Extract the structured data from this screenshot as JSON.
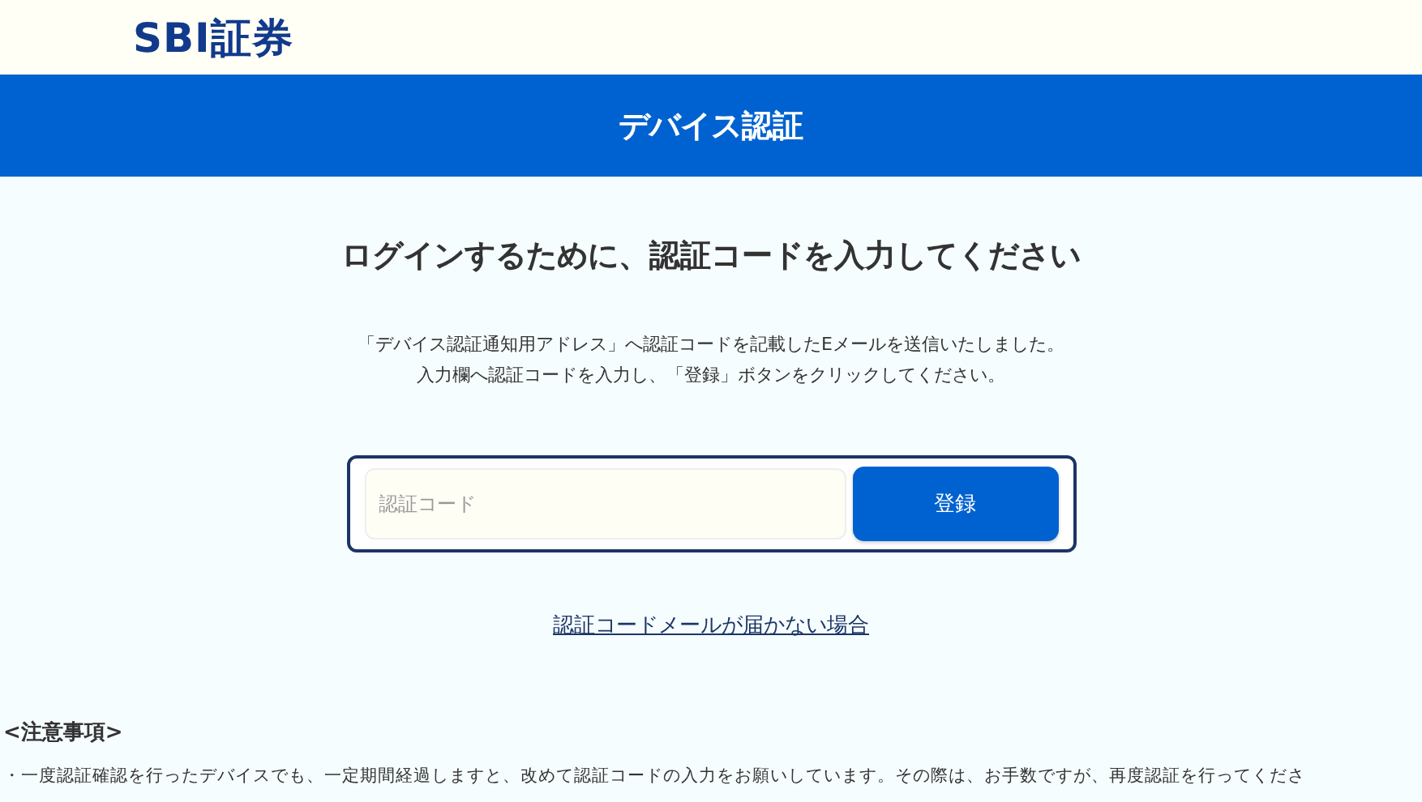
{
  "logo": "SBI証券",
  "banner": {
    "title": "デバイス認証"
  },
  "heading": "ログインするために、認証コードを入力してください",
  "instructions": [
    "「デバイス認証通知用アドレス」へ認証コードを記載したEメールを送信いたしました。",
    "入力欄へ認証コードを入力し、「登録」ボタンをクリックしてください。"
  ],
  "form": {
    "placeholder": "認証コード",
    "button": "登録"
  },
  "help_link": "認証コードメールが届かない場合",
  "notes": {
    "title": "<注意事項>",
    "items": [
      "・一度認証確認を行ったデバイスでも、一定期間経過しますと、改めて認証コードの入力をお願いしています。その際は、お手数ですが、再度認証を行ってくださ"
    ]
  }
}
